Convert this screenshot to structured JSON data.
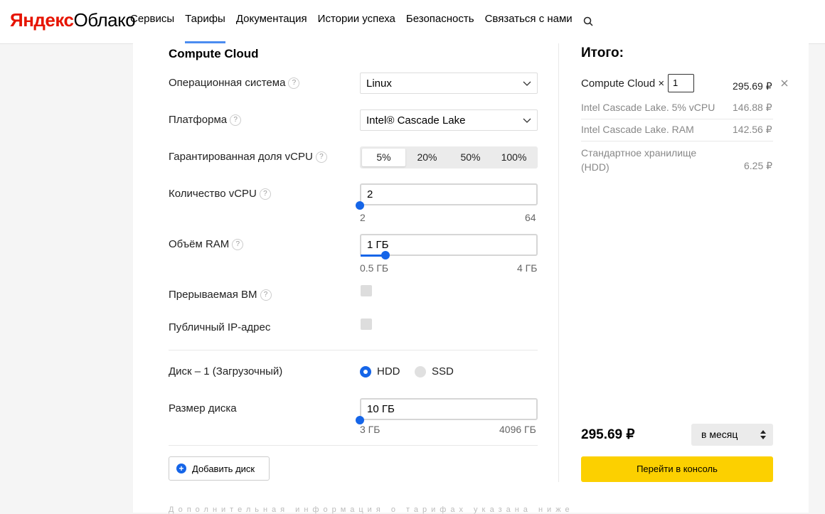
{
  "header": {
    "logo_part1": "Яндекс",
    "logo_part2": "Облако",
    "nav": [
      "Сервисы",
      "Тарифы",
      "Документация",
      "Истории успеха",
      "Безопасность",
      "Связаться с нами"
    ],
    "active_nav": "Тарифы",
    "search_icon": "search-icon"
  },
  "config": {
    "title": "Compute Cloud",
    "os_label": "Операционная система",
    "os_value": "Linux",
    "platform_label": "Платформа",
    "platform_value": "Intel® Cascade Lake",
    "vcpu_share_label": "Гарантированная доля vCPU",
    "vcpu_share_options": [
      "5%",
      "20%",
      "50%",
      "100%"
    ],
    "vcpu_share_selected": "5%",
    "vcpu_count_label": "Количество vCPU",
    "vcpu_count_value": "2",
    "vcpu_min": "2",
    "vcpu_max": "64",
    "ram_label": "Объём RAM",
    "ram_value": "1 ГБ",
    "ram_min": "0.5 ГБ",
    "ram_max": "4 ГБ",
    "preemptible_label": "Прерываемая ВМ",
    "public_ip_label": "Публичный IP-адрес",
    "disk_label": "Диск – 1 (Загрузочный)",
    "disk_types": [
      "HDD",
      "SSD"
    ],
    "disk_type_selected": "HDD",
    "disk_size_label": "Размер диска",
    "disk_size_value": "10 ГБ",
    "disk_min": "3 ГБ",
    "disk_max": "4096 ГБ",
    "add_disk_label": "Добавить диск",
    "question_mark": "?",
    "plus_sign": "+"
  },
  "summary": {
    "title": "Итого:",
    "service_label": "Compute Cloud ×",
    "quantity": "1",
    "service_price": "295.69 ₽",
    "lines": [
      {
        "label": "Intel Cascade Lake. 5% vCPU",
        "price": "146.88 ₽"
      },
      {
        "label": "Intel Cascade Lake. RAM",
        "price": "142.56 ₽"
      },
      {
        "label": "Стандартное хранилище (HDD)",
        "price": "6.25 ₽"
      }
    ],
    "total": "295.69 ₽",
    "period": "в месяц",
    "console_button": "Перейти в консоль"
  },
  "footnote": "Дополнительная информация о тарифах указана ниже"
}
